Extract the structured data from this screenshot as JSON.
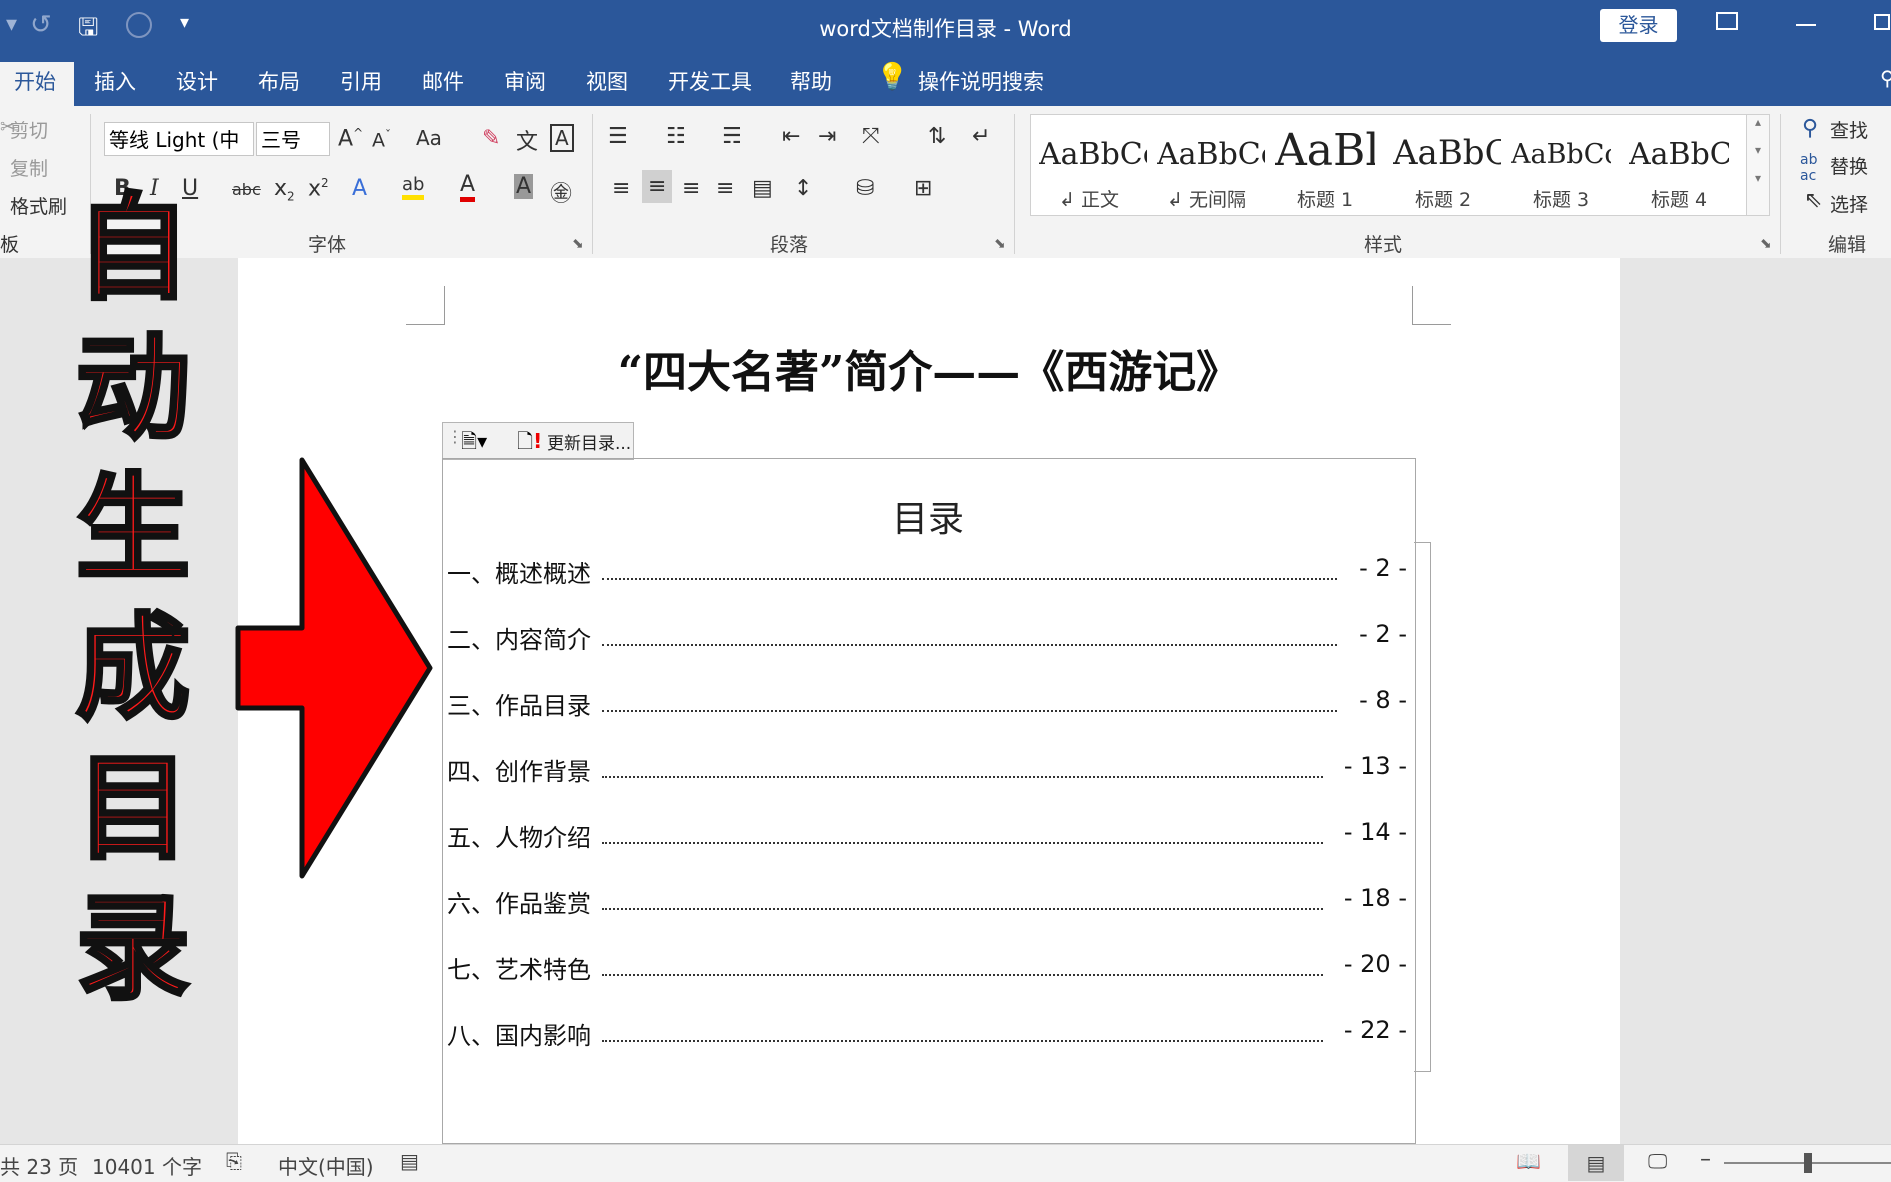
{
  "window": {
    "title": "word文档制作目录 - Word",
    "login_label": "登录"
  },
  "tabs": [
    "开始",
    "插入",
    "设计",
    "布局",
    "引用",
    "邮件",
    "审阅",
    "视图",
    "开发工具",
    "帮助"
  ],
  "tell_me": "操作说明搜索",
  "clipboard": {
    "cut": "剪切",
    "copy": "复制",
    "format_painter": "格式刷",
    "group_label": "板"
  },
  "font": {
    "name": "等线 Light (中",
    "size": "三号",
    "change_case": "Aa",
    "group_label": "字体"
  },
  "paragraph": {
    "group_label": "段落"
  },
  "styles": {
    "group_label": "样式",
    "items": [
      {
        "sample": "AaBbCc",
        "label": "↲ 正文"
      },
      {
        "sample": "AaBbCc",
        "label": "↲ 无间隔"
      },
      {
        "sample": "AaBl",
        "label": "标题 1"
      },
      {
        "sample": "AaBbC",
        "label": "标题 2"
      },
      {
        "sample": "AaBbCc",
        "label": "标题 3"
      },
      {
        "sample": "AaBbCc",
        "label": "标题 4"
      }
    ]
  },
  "editing": {
    "find": "查找",
    "replace": "替换",
    "select": "选择",
    "group_label": "编辑"
  },
  "overlay": {
    "chars": [
      "自",
      "动",
      "生",
      "成",
      "目",
      "录"
    ],
    "arrow_color": "#ff0000"
  },
  "document": {
    "title": "“四大名著”简介——《西游记》",
    "toc_toolbar_label": "更新目录...",
    "toc_heading": "目录",
    "toc": [
      {
        "label": "一、概述概述",
        "page": "- 2 -"
      },
      {
        "label": "二、内容简介",
        "page": "- 2 -"
      },
      {
        "label": "三、作品目录",
        "page": "- 8 -"
      },
      {
        "label": "四、创作背景",
        "page": "- 13 -"
      },
      {
        "label": "五、人物介绍",
        "page": "- 14 -"
      },
      {
        "label": "六、作品鉴赏",
        "page": "- 18 -"
      },
      {
        "label": "七、艺术特色",
        "page": "- 20 -"
      },
      {
        "label": "八、国内影响",
        "page": "- 22 -"
      }
    ]
  },
  "status": {
    "pages": "共 23 页",
    "words": "10401 个字",
    "language": "中文(中国)"
  },
  "colors": {
    "ribbon_blue": "#2b579a",
    "accent_red": "#ff1a1a"
  }
}
